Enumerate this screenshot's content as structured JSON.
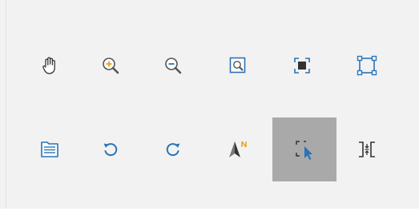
{
  "toolbar": {
    "rows": [
      {
        "tools": [
          {
            "name": "pan-tool",
            "icon": "hand-icon"
          },
          {
            "name": "zoom-in-tool",
            "icon": "zoom-in-icon"
          },
          {
            "name": "zoom-out-tool",
            "icon": "zoom-out-icon"
          },
          {
            "name": "zoom-to-selection-tool",
            "icon": "zoom-window-icon"
          },
          {
            "name": "zoom-to-full-extent-tool",
            "icon": "full-extent-icon"
          },
          {
            "name": "zoom-to-layer-tool",
            "icon": "layer-extent-icon"
          }
        ]
      },
      {
        "tools": [
          {
            "name": "layer-properties-tool",
            "icon": "document-list-icon"
          },
          {
            "name": "undo-extent-tool",
            "icon": "rotate-left-icon"
          },
          {
            "name": "redo-extent-tool",
            "icon": "rotate-right-icon"
          },
          {
            "name": "north-arrow-tool",
            "icon": "north-arrow-icon"
          },
          {
            "name": "select-features-tool",
            "icon": "select-cursor-icon",
            "selected": true
          },
          {
            "name": "identify-tool",
            "icon": "split-bracket-icon"
          }
        ]
      }
    ],
    "colors": {
      "panel_background": "#f2f2f2",
      "selected_background": "#a9a9a9",
      "icon_blue": "#2a73b8",
      "icon_orange": "#e8a317",
      "icon_dark": "#333333"
    }
  }
}
